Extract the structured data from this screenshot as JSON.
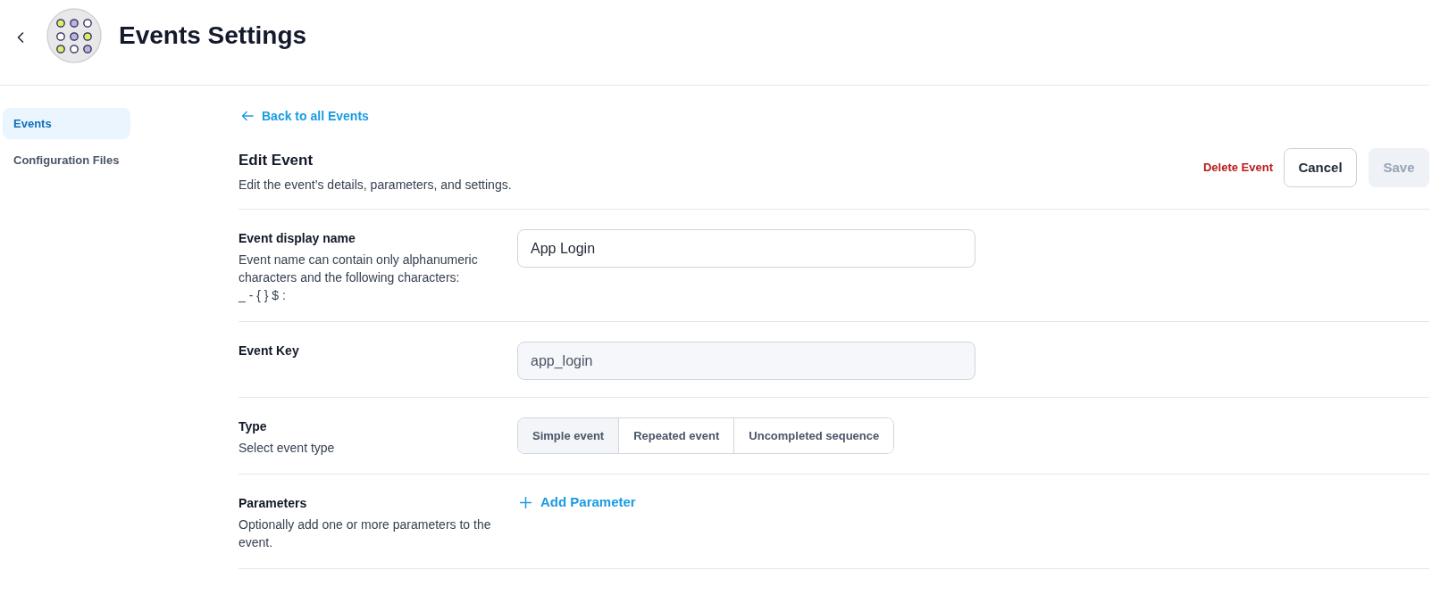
{
  "header": {
    "title": "Events Settings"
  },
  "sidebar": {
    "items": [
      {
        "label": "Events",
        "selected": true
      },
      {
        "label": "Configuration Files",
        "selected": false
      }
    ]
  },
  "back_link": "Back to all Events",
  "edit_event": {
    "title": "Edit Event",
    "description": "Edit the event’s details, parameters, and settings.",
    "actions": [
      {
        "kind": "danger",
        "label": "Delete Event"
      },
      {
        "kind": "secondary",
        "label": "Cancel"
      },
      {
        "kind": "primary",
        "label": "Save",
        "disabled": true
      }
    ]
  },
  "rows": [
    {
      "kind": "input",
      "label": "Event display name",
      "help": "Event name can contain only alphanumeric characters and the following characters:",
      "allowed_characters": "_ - { } $ :",
      "value": "App Login",
      "disabled": false
    },
    {
      "kind": "input",
      "label": "Event Key",
      "value": "app_login",
      "disabled": true
    },
    {
      "kind": "segmented",
      "label": "Type",
      "help": "Select event type",
      "options": [
        {
          "label": "Simple event",
          "selected": true
        },
        {
          "label": "Repeated event",
          "selected": false
        },
        {
          "label": "Uncompleted sequence",
          "selected": false
        }
      ]
    },
    {
      "kind": "add",
      "label": "Parameters",
      "help": "Optionally add one or more parameters to the event.",
      "button": "Add Parameter"
    }
  ]
}
